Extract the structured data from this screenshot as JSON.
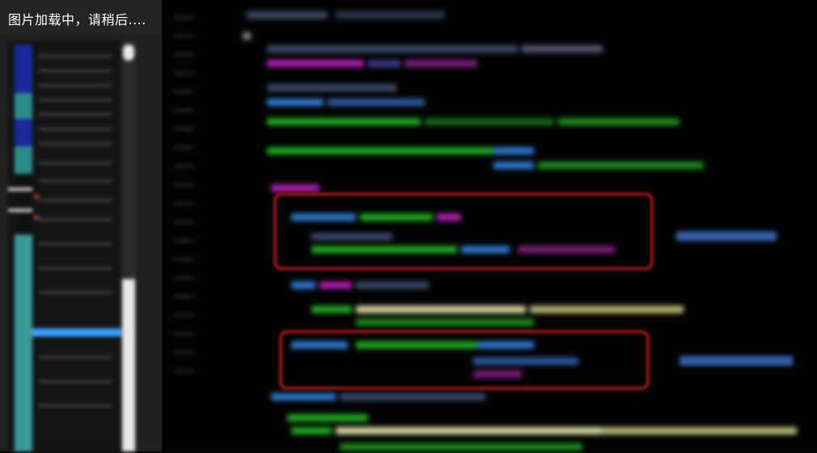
{
  "overlay": {
    "loading_text": "图片加载中，请稍后...."
  },
  "colors": {
    "background": "#030303",
    "highlight_box": "#9a1515",
    "annotation": "#3b6fc4",
    "tree_selection": "#3aa0ff"
  },
  "icons": [
    "folder-tree",
    "scrollbar-thumb"
  ]
}
